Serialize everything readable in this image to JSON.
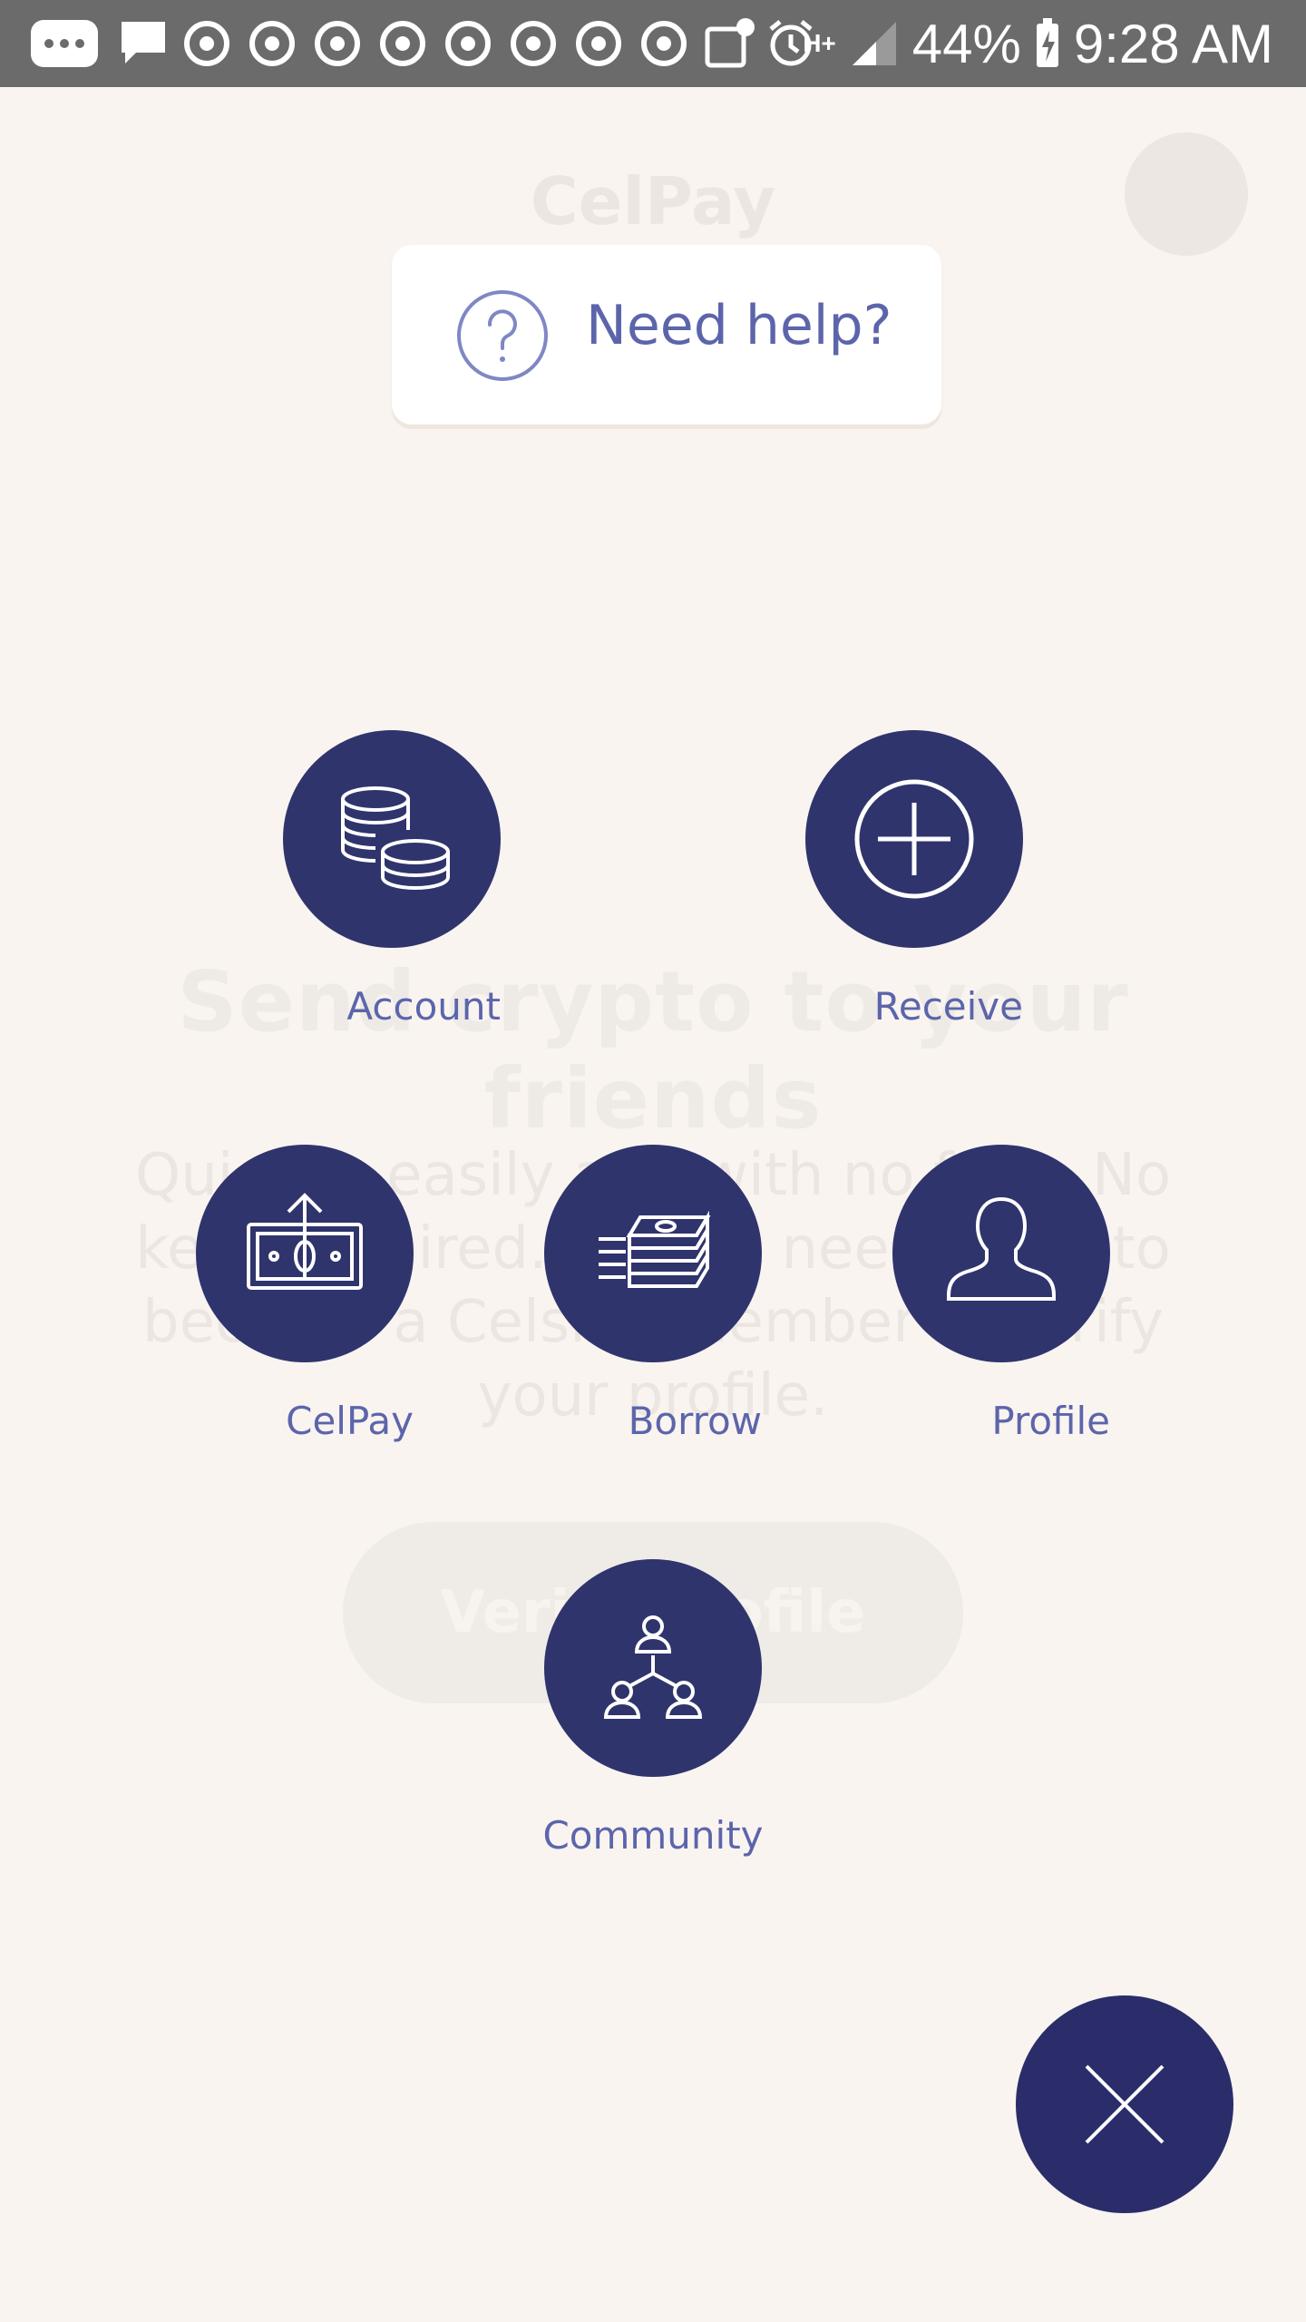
{
  "status_bar": {
    "battery_percent": "44%",
    "time": "9:28 AM",
    "network": "H+",
    "notification_icons": [
      "more-messages-icon",
      "chat-bubble-icon",
      "chrome-icon",
      "chrome-icon",
      "chrome-icon",
      "chrome-icon",
      "chrome-icon",
      "chrome-icon",
      "chrome-icon",
      "chrome-icon",
      "voicemail-icon",
      "alarm-icon"
    ]
  },
  "background_page": {
    "title": "CelPay",
    "heading": "Send crypto to your friends",
    "description": "Quickly, easily and with no fees. No keys required. All you need to do to become a Celsius member is verify your profile.",
    "button_label": "Verify profile"
  },
  "help": {
    "label": "Need help?"
  },
  "menu": {
    "account": "Account",
    "receive": "Receive",
    "celpay": "CelPay",
    "borrow": "Borrow",
    "profile": "Profile",
    "community": "Community"
  },
  "colors": {
    "background": "#f9f4f0",
    "accent_dark": "#2f346d",
    "label": "#5c65ab"
  }
}
